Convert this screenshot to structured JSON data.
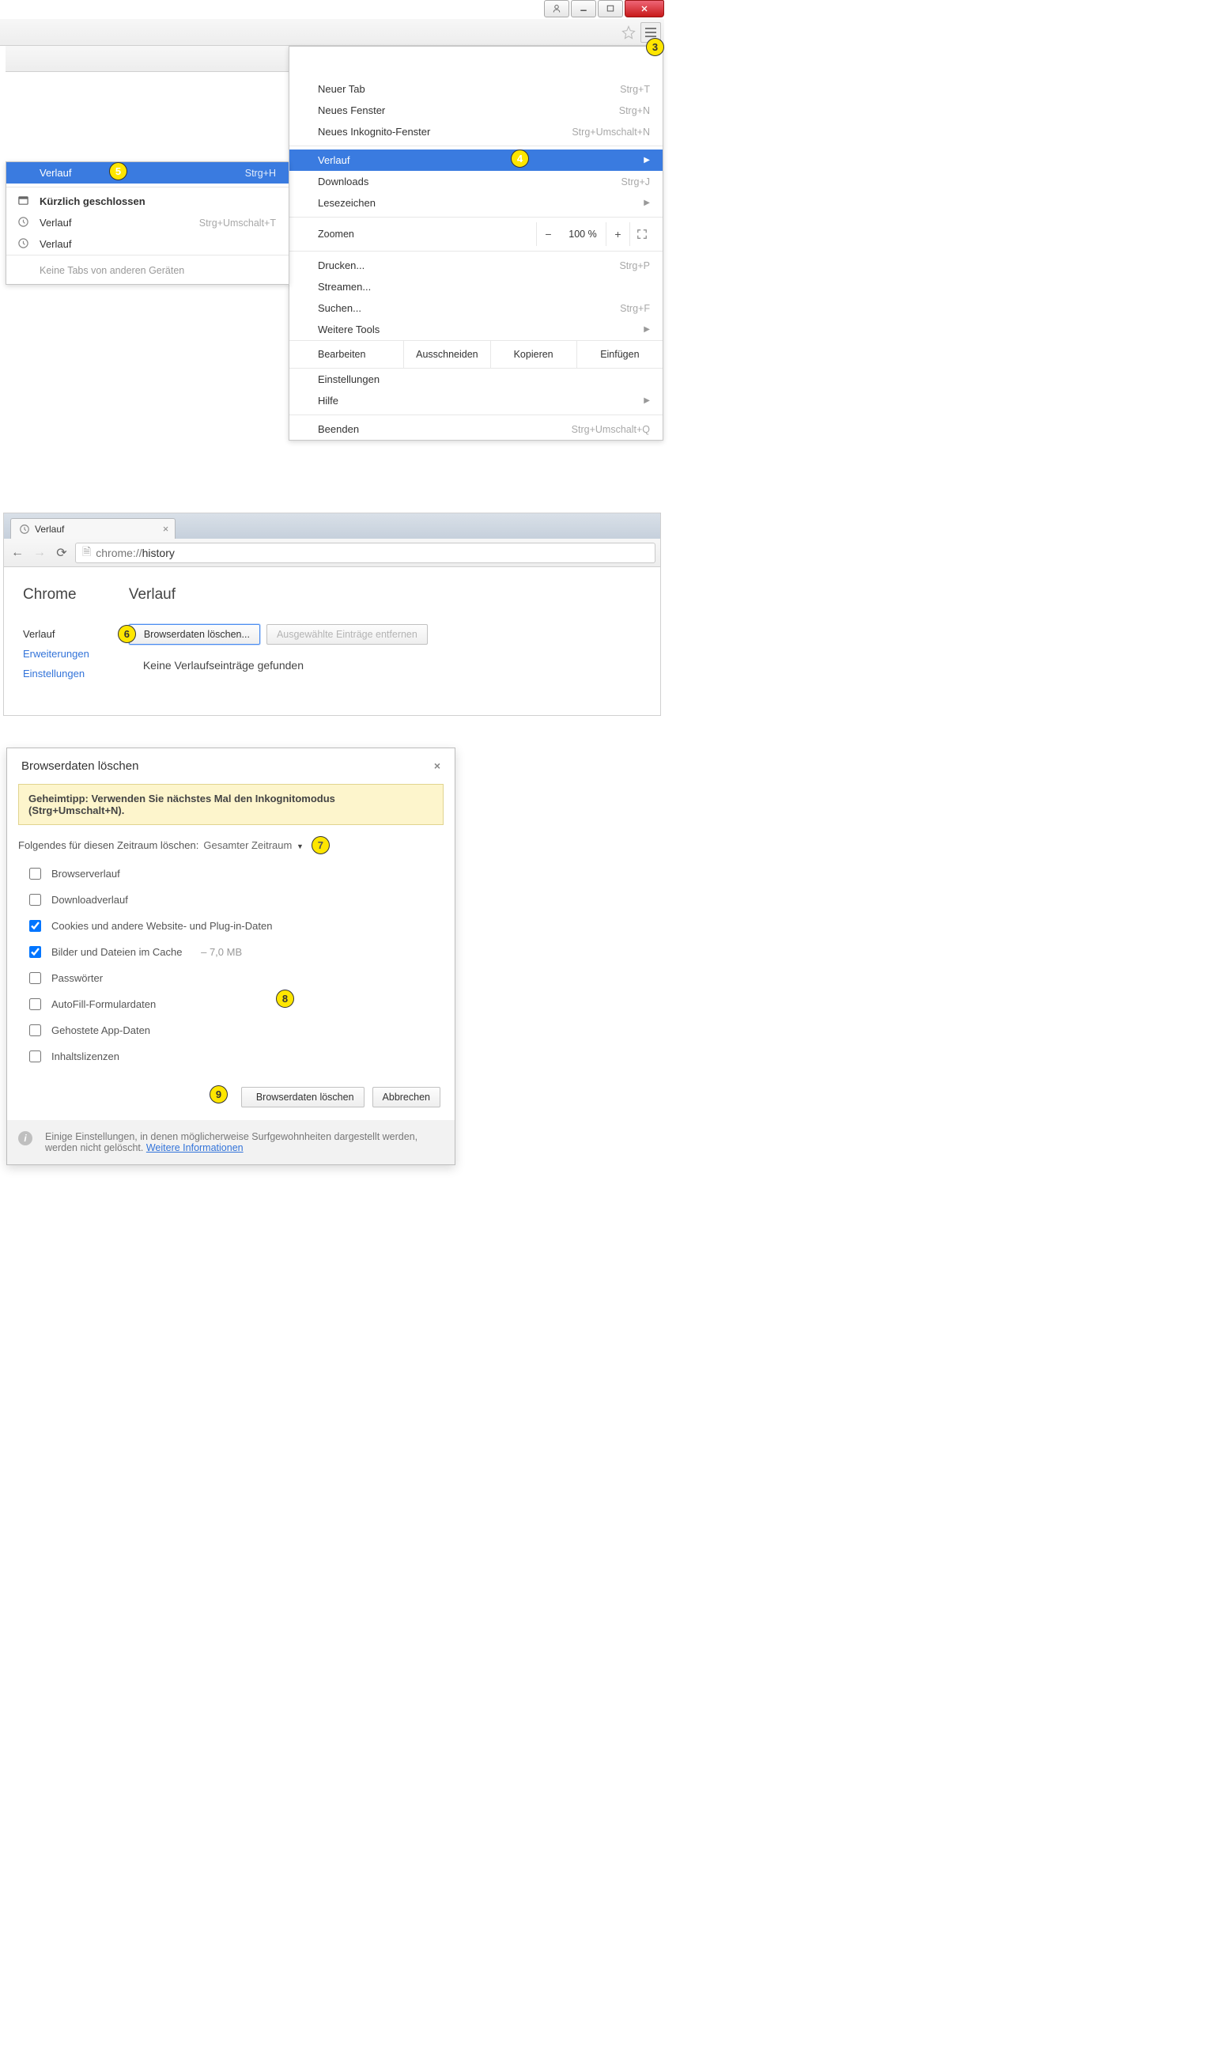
{
  "callouts": {
    "c3": "3",
    "c4": "4",
    "c5": "5",
    "c6": "6",
    "c7": "7",
    "c8": "8",
    "c9": "9"
  },
  "titlebar": {},
  "menu_main": {
    "new_tab": {
      "label": "Neuer Tab",
      "sc": "Strg+T"
    },
    "new_window": {
      "label": "Neues Fenster",
      "sc": "Strg+N"
    },
    "new_incognito": {
      "label": "Neues Inkognito-Fenster",
      "sc": "Strg+Umschalt+N"
    },
    "history": {
      "label": "Verlauf"
    },
    "downloads": {
      "label": "Downloads",
      "sc": "Strg+J"
    },
    "bookmarks": {
      "label": "Lesezeichen"
    },
    "zoom_label": "Zoomen",
    "zoom_value": "100 %",
    "print": {
      "label": "Drucken...",
      "sc": "Strg+P"
    },
    "cast": {
      "label": "Streamen..."
    },
    "find": {
      "label": "Suchen...",
      "sc": "Strg+F"
    },
    "more_tools": {
      "label": "Weitere Tools"
    },
    "edit": {
      "label": "Bearbeiten",
      "cut": "Ausschneiden",
      "copy": "Kopieren",
      "paste": "Einfügen"
    },
    "settings": {
      "label": "Einstellungen"
    },
    "help": {
      "label": "Hilfe"
    },
    "exit": {
      "label": "Beenden",
      "sc": "Strg+Umschalt+Q"
    }
  },
  "menu_history": {
    "head": {
      "label": "Verlauf",
      "sc": "Strg+H"
    },
    "recently_closed": "Kürzlich geschlossen",
    "item1": {
      "label": "Verlauf",
      "sc": "Strg+Umschalt+T"
    },
    "item2": {
      "label": "Verlauf"
    },
    "no_tabs": "Keine Tabs von anderen Geräten"
  },
  "history_page": {
    "tab_title": "Verlauf",
    "url_prefix": "chrome://",
    "url_rest": "history",
    "side_title": "Chrome",
    "nav": {
      "history": "Verlauf",
      "extensions": "Erweiterungen",
      "settings": "Einstellungen"
    },
    "main_title": "Verlauf",
    "btn_clear": "Browserdaten löschen...",
    "btn_remove": "Ausgewählte Einträge entfernen",
    "empty": "Keine Verlaufseinträge gefunden"
  },
  "dialog": {
    "title": "Browserdaten löschen",
    "tip": "Geheimtipp: Verwenden Sie nächstes Mal den Inkognitomodus (Strg+Umschalt+N).",
    "period_label": "Folgendes für diesen Zeitraum löschen:",
    "period_value": "Gesamter Zeitraum",
    "options": {
      "browsing": "Browserverlauf",
      "download": "Downloadverlauf",
      "cookies": "Cookies und andere Website- und Plug-in-Daten",
      "cache": "Bilder und Dateien im Cache",
      "cache_extra": "–  7,0 MB",
      "passwords": "Passwörter",
      "autofill": "AutoFill-Formulardaten",
      "hosted": "Gehostete App-Daten",
      "licenses": "Inhaltslizenzen"
    },
    "ok": "Browserdaten löschen",
    "cancel": "Abbrechen",
    "footer": "Einige Einstellungen, in denen möglicherweise Surfgewohnheiten dargestellt werden, werden nicht gelöscht. ",
    "footer_link": "Weitere Informationen"
  }
}
